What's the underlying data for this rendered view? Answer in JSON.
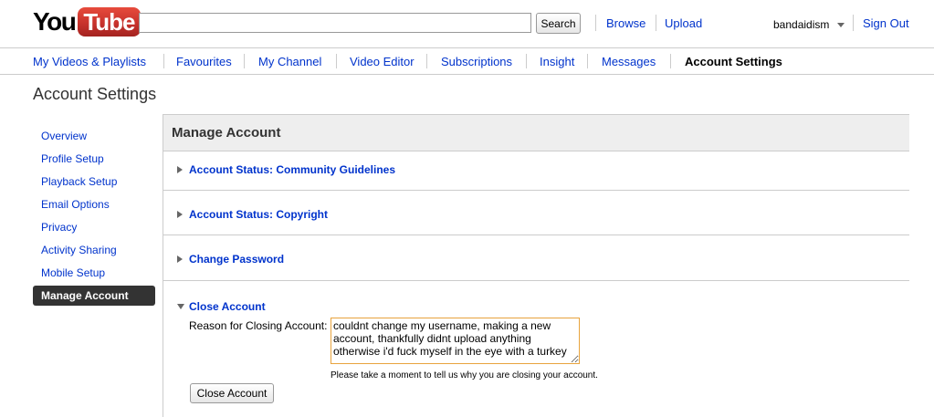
{
  "masthead": {
    "logo_you": "You",
    "logo_tube": "Tube",
    "search": {
      "value": "",
      "placeholder": ""
    },
    "search_label": "Search",
    "browse_label": "Browse",
    "upload_label": "Upload",
    "username": "bandaidism",
    "sign_out_label": "Sign Out"
  },
  "nav": {
    "items": [
      {
        "label": "My Videos & Playlists"
      },
      {
        "label": "Favourites"
      },
      {
        "label": "My Channel"
      },
      {
        "label": "Video Editor"
      },
      {
        "label": "Subscriptions"
      },
      {
        "label": "Insight"
      },
      {
        "label": "Messages"
      },
      {
        "label": "Account Settings",
        "active": true
      }
    ]
  },
  "page_title": "Account Settings",
  "sidebar": {
    "items": [
      {
        "label": "Overview"
      },
      {
        "label": "Profile Setup"
      },
      {
        "label": "Playback Setup"
      },
      {
        "label": "Email Options"
      },
      {
        "label": "Privacy"
      },
      {
        "label": "Activity Sharing"
      },
      {
        "label": "Mobile Setup"
      },
      {
        "label": "Manage Account",
        "active": true
      }
    ]
  },
  "content": {
    "title": "Manage Account",
    "sections": [
      {
        "label": "Account Status: Community Guidelines",
        "expanded": false
      },
      {
        "label": "Account Status: Copyright",
        "expanded": false
      },
      {
        "label": "Change Password",
        "expanded": false
      },
      {
        "label": "Close Account",
        "expanded": true
      }
    ],
    "close_account": {
      "reason_label": "Reason for Closing Account:",
      "reason_value": "couldnt change my username, making a new account, thankfully didnt upload anything otherwise i'd fuck myself in the eye with a turkey",
      "help_text": "Please take a moment to tell us why you are closing your account.",
      "button_label": "Close Account"
    }
  },
  "colors": {
    "link": "#0033cc",
    "sidebar_active_bg": "#333333",
    "header_bg": "#eeeeee",
    "focus_border": "#e8a33d",
    "logo_red": "#c4302b"
  }
}
